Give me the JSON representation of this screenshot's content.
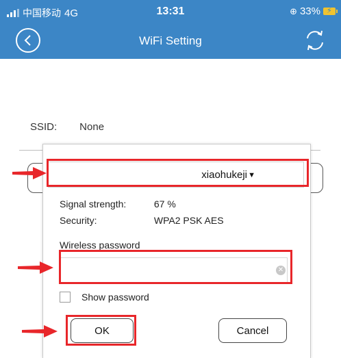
{
  "status_bar": {
    "carrier": "中国移动",
    "network": "4G",
    "time": "13:31",
    "battery": "33%"
  },
  "nav": {
    "title": "WiFi Setting",
    "back_icon": "chevron-left-icon",
    "refresh_icon": "refresh-icon"
  },
  "page": {
    "ssid_label": "SSID:",
    "ssid_value": "None"
  },
  "dialog": {
    "ssid_selected": "xiaohukeji",
    "caret": "▼",
    "signal_label": "Signal strength:",
    "signal_value": "67 %",
    "security_label": "Security:",
    "security_value": "WPA2 PSK AES",
    "password_label": "Wireless password",
    "password_value": "",
    "show_password_label": "Show password",
    "show_password_checked": false,
    "ok_label": "OK",
    "cancel_label": "Cancel"
  },
  "colors": {
    "header": "#3c86c6",
    "annotation": "#e8262a",
    "battery": "#f0c330"
  }
}
